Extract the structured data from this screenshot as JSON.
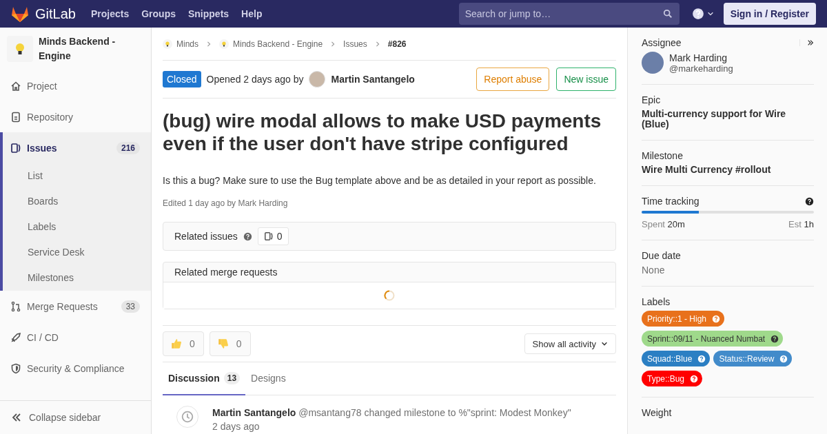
{
  "topbar": {
    "brand": "GitLab",
    "nav": [
      "Projects",
      "Groups",
      "Snippets",
      "Help"
    ],
    "search": {
      "placeholder": "Search or jump to…"
    },
    "sign_in": "Sign in / Register"
  },
  "sidebar": {
    "project": "Minds Backend - Engine",
    "items": [
      {
        "label": "Project",
        "selected": false
      },
      {
        "label": "Repository",
        "selected": false
      },
      {
        "label": "Issues",
        "count": "216",
        "selected": true,
        "children": [
          {
            "label": "List",
            "selected": false
          },
          {
            "label": "Boards",
            "selected": false
          },
          {
            "label": "Labels",
            "selected": false
          },
          {
            "label": "Service Desk",
            "selected": false
          },
          {
            "label": "Milestones",
            "selected": false
          }
        ]
      },
      {
        "label": "Merge Requests",
        "count": "33",
        "selected": false
      },
      {
        "label": "CI / CD",
        "selected": false
      },
      {
        "label": "Security & Compliance",
        "selected": false
      }
    ],
    "collapse": "Collapse sidebar"
  },
  "issue": {
    "breadcrumbs": [
      {
        "label": "Minds",
        "kind": "group"
      },
      {
        "label": "Minds Backend - Engine",
        "kind": "group"
      },
      {
        "label": "Issues",
        "kind": "link"
      },
      {
        "label": "#826",
        "kind": "current"
      }
    ],
    "status": "Closed",
    "opened": "Opened 2 days ago by",
    "author": "Martin Santangelo",
    "buttons": [
      {
        "label": "Report abuse",
        "kind": "warning"
      },
      {
        "label": "New issue",
        "kind": "success"
      }
    ],
    "title": "(bug) wire modal allows to make USD payments even if the user don't have stripe configured",
    "description": "Is this a bug? Make sure to use the Bug template above and be as detailed in your report as possible.",
    "edited": "Edited 1 day ago by Mark Harding",
    "related_issues": {
      "title": "Related issues",
      "count": "0"
    },
    "related_merge_requests": {
      "title": "Related merge requests",
      "loading": true
    },
    "reactions": [
      {
        "kind": "thumbsup",
        "count": "0"
      },
      {
        "kind": "thumbsdown",
        "count": "0"
      }
    ],
    "activity_filter": "Show all activity",
    "tabs": [
      {
        "label": "Discussion",
        "count": "13",
        "selected": true
      },
      {
        "label": "Designs",
        "selected": false
      }
    ],
    "notes": [
      {
        "author": "Martin Santangelo",
        "text": "@msantang78 changed milestone to %\"sprint: Modest Monkey\"",
        "time": "2 days ago"
      }
    ]
  },
  "right_sidebar": {
    "assignee": {
      "title": "Assignee",
      "name": "Mark Harding",
      "username": "@markeharding"
    },
    "epic": {
      "title": "Epic",
      "value": "Multi-currency support for Wire (Blue)"
    },
    "milestone": {
      "title": "Milestone",
      "value": "Wire Multi Currency #rollout"
    },
    "time_tracking": {
      "title": "Time tracking",
      "level": 0.33,
      "spent_label": "Spent",
      "spent": "20m",
      "estimate_label": "Est",
      "estimate": "1h"
    },
    "due_date": {
      "title": "Due date",
      "value": "None"
    },
    "labels": {
      "title": "Labels",
      "items": [
        {
          "text": "Priority::1 - High",
          "color": "#e8711c"
        },
        {
          "text": "Sprint::09/11 - Nuanced Numbat",
          "color": "#9fd98b"
        },
        {
          "text": "Squad::Blue",
          "color": "#2b7fc3"
        },
        {
          "text": "Status::Review",
          "color": "#428bca"
        },
        {
          "text": "Type::Bug",
          "color": "#ff0000"
        }
      ]
    },
    "weight": {
      "title": "Weight"
    }
  }
}
